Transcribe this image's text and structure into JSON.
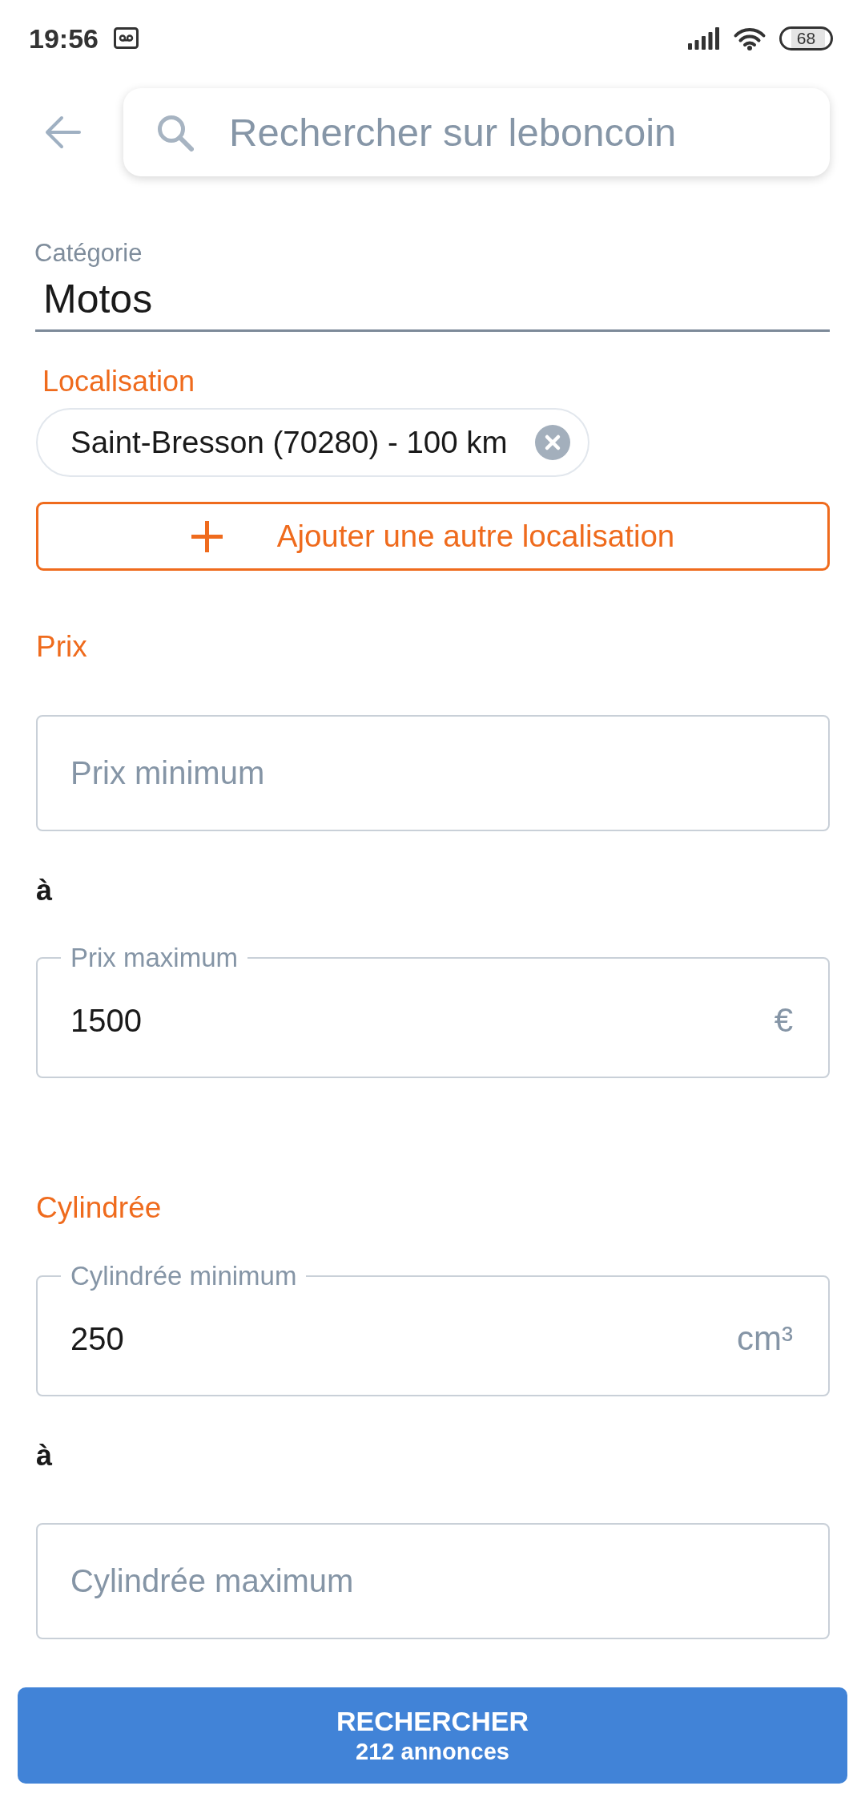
{
  "status_bar": {
    "time": "19:56",
    "battery": "68"
  },
  "search": {
    "placeholder": "Rechercher sur leboncoin"
  },
  "category": {
    "label": "Catégorie",
    "value": "Motos"
  },
  "location": {
    "label": "Localisation",
    "chips": [
      {
        "text": "Saint-Bresson (70280) - 100 km"
      }
    ],
    "add_button": "Ajouter une autre localisation"
  },
  "filters": [
    {
      "title": "Prix",
      "separator": "à",
      "fields": [
        {
          "kind": "placeholder",
          "placeholder": "Prix minimum"
        },
        {
          "kind": "filled",
          "label": "Prix maximum",
          "value": "1500",
          "unit": "€"
        }
      ]
    },
    {
      "title": "Cylindrée",
      "separator": "à",
      "fields": [
        {
          "kind": "filled",
          "label": "Cylindrée minimum",
          "value": "250",
          "unit": "cm³"
        },
        {
          "kind": "placeholder",
          "placeholder": "Cylindrée maximum"
        }
      ]
    }
  ],
  "search_button": {
    "label": "RECHERCHER",
    "count": "212 annonces"
  }
}
